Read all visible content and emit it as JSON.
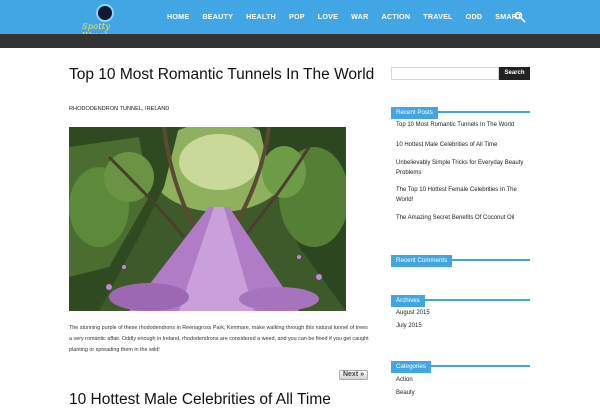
{
  "site": {
    "logo_text": "Spotty Wreck"
  },
  "nav": {
    "items": [
      "HOME",
      "BEAUTY",
      "HEALTH",
      "POP",
      "LOVE",
      "WAR",
      "ACTION",
      "TRAVEL",
      "ODD",
      "SMART"
    ]
  },
  "post": {
    "title": "Top 10 Most Romantic Tunnels In The World",
    "subtitle": "RHODODENDRON TUNNEL, IRELAND",
    "body": "The stunning purple of these rhododendrons in Reenagross Park, Kenmare, make walking through this natural tunnel of trees a very romantic affair. Oddly enough in Ireland, rhododendrons are considered a weed, and you can be fined if you get caught planting or spreading them in the wild!",
    "next_label": "Next »"
  },
  "next_post": {
    "title": "10 Hottest Male Celebrities of All Time"
  },
  "sidebar": {
    "search_button": "Search",
    "recent_posts": {
      "title": "Recent Posts",
      "items": [
        "Top 10 Most Romantic Tunnels In The World",
        "10 Hottest Male Celebrities of All Time",
        "Unbelievably Simple Tricks for Everyday Beauty Problems",
        "The Top 10 Hottest Female Celebrities In The World!",
        "The Amazing Secret Benefits Of Coconut Oil"
      ]
    },
    "recent_comments": {
      "title": "Recent Comments"
    },
    "archives": {
      "title": "Archives",
      "items": [
        "August 2015",
        "July 2015"
      ]
    },
    "categories": {
      "title": "Categories",
      "items": [
        "Action",
        "Beauty"
      ]
    }
  },
  "colors": {
    "accent": "#42a6e4",
    "dark_bar": "#333333",
    "path_purple": "#b07cc6"
  }
}
